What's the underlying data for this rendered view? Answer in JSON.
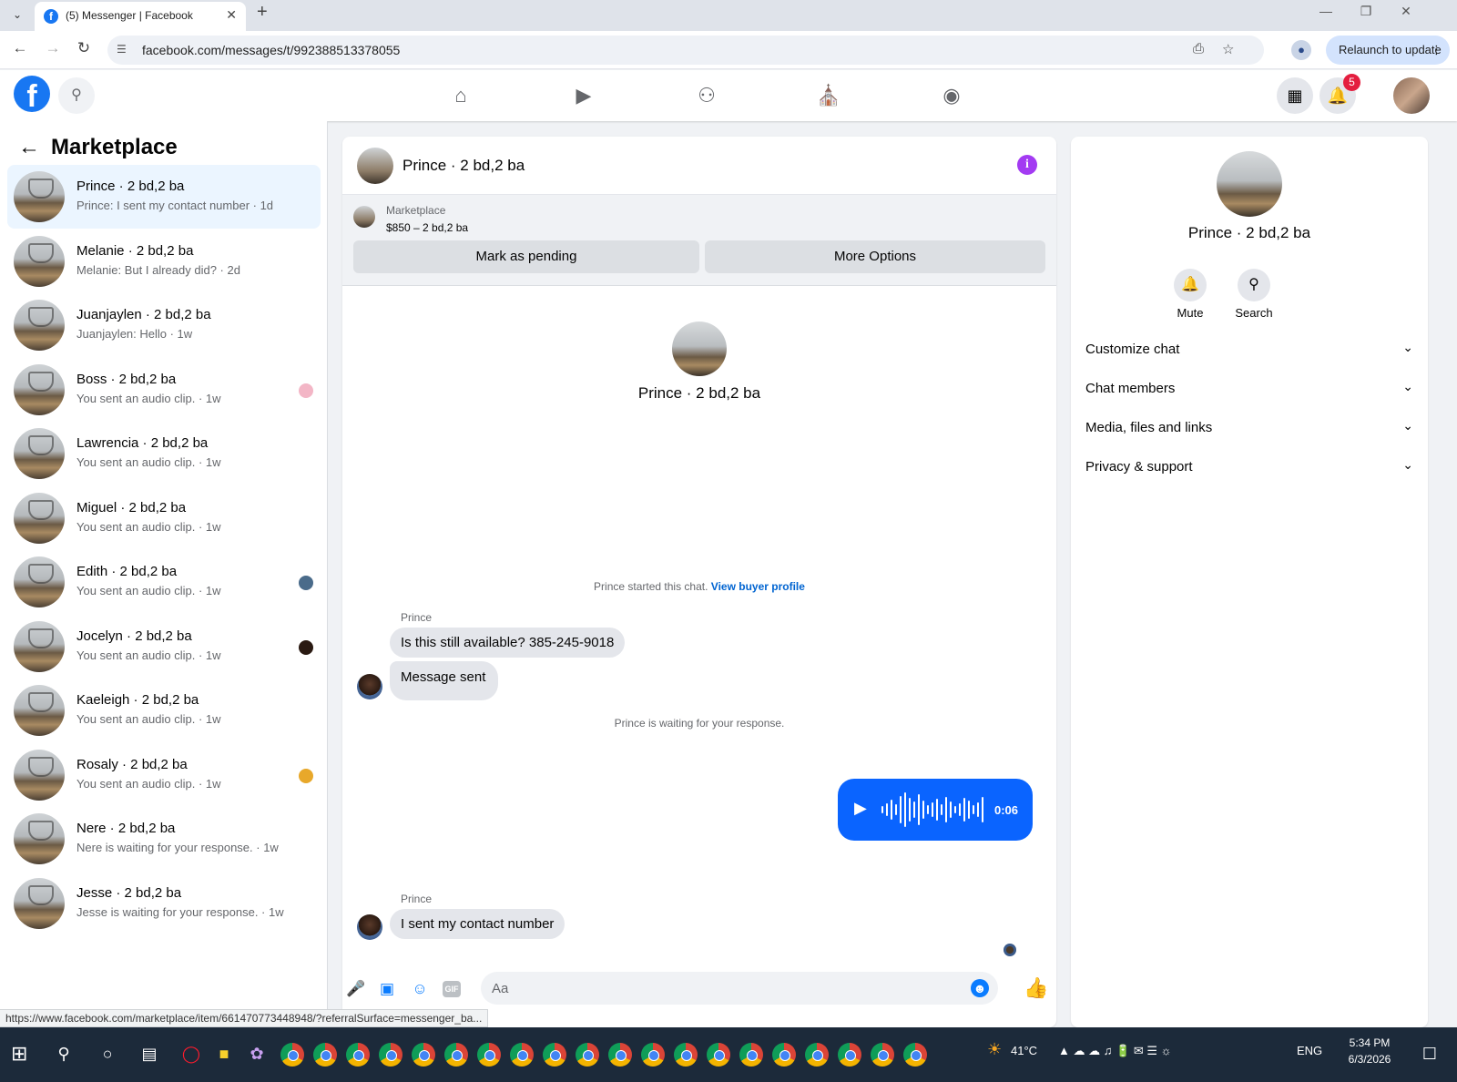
{
  "browser": {
    "tab_title": "(5) Messenger | Facebook",
    "url": "facebook.com/messages/t/992388513378055",
    "relaunch_label": "Relaunch to update",
    "status_url": "https://www.facebook.com/marketplace/item/661470773448948/?referralSurface=messenger_ba..."
  },
  "fb_header": {
    "notification_count": "5",
    "nav_icons": [
      "home-icon",
      "reels-icon",
      "friends-icon",
      "marketplace-icon",
      "groups-icon"
    ]
  },
  "sidebar": {
    "title": "Marketplace",
    "conversations": [
      {
        "name": "Prince · 2 bd,2 ba",
        "preview": "Prince: I sent my contact number · 1d",
        "active": true
      },
      {
        "name": "Melanie · 2 bd,2 ba",
        "preview": "Melanie: But I already did? · 2d"
      },
      {
        "name": "Juanjaylen · 2 bd,2 ba",
        "preview": "Juanjaylen: Hello · 1w"
      },
      {
        "name": "Boss · 2 bd,2 ba",
        "preview": "You sent an audio clip. · 1w",
        "seen_color": "#f3b6c6"
      },
      {
        "name": "Lawrencia · 2 bd,2 ba",
        "preview": "You sent an audio clip. · 1w"
      },
      {
        "name": "Miguel · 2 bd,2 ba",
        "preview": "You sent an audio clip. · 1w"
      },
      {
        "name": "Edith · 2 bd,2 ba",
        "preview": "You sent an audio clip. · 1w",
        "seen_color": "#4a6b8a"
      },
      {
        "name": "Jocelyn · 2 bd,2 ba",
        "preview": "You sent an audio clip. · 1w",
        "seen_color": "#2a1a12"
      },
      {
        "name": "Kaeleigh · 2 bd,2 ba",
        "preview": "You sent an audio clip. · 1w"
      },
      {
        "name": "Rosaly · 2 bd,2 ba",
        "preview": "You sent an audio clip. · 1w",
        "seen_color": "#e8a82a"
      },
      {
        "name": "Nere · 2 bd,2 ba",
        "preview": "Nere is waiting for your response. · 1w"
      },
      {
        "name": "Jesse · 2 bd,2 ba",
        "preview": "Jesse is waiting for your response. · 1w"
      }
    ]
  },
  "chat": {
    "header_name": "Prince · 2 bd,2 ba",
    "marketplace_label": "Marketplace",
    "listing": "$850 – 2 bd,2 ba",
    "mark_pending_label": "Mark as pending",
    "more_options_label": "More Options",
    "intro_name": "Prince · 2 bd,2 ba",
    "started_text": "Prince started this chat.",
    "view_profile_label": "View buyer profile",
    "messages": [
      {
        "sender": "Prince",
        "text": "Is this still available? 385-245-9018"
      },
      {
        "text": "Message sent"
      },
      {
        "sender": "Prince",
        "text": "I sent my contact number"
      }
    ],
    "waiting_text": "Prince is waiting for your response.",
    "audio_duration": "0:06",
    "composer_placeholder": "Aa",
    "gif_label": "GIF"
  },
  "info_panel": {
    "name": "Prince · 2 bd,2 ba",
    "mute_label": "Mute",
    "search_label": "Search",
    "sections": [
      "Customize chat",
      "Chat members",
      "Media, files and links",
      "Privacy & support"
    ]
  },
  "taskbar": {
    "temperature": "41°C",
    "language": "ENG",
    "time": "5:34 PM",
    "date": "6/3/2026"
  },
  "colors": {
    "fb_blue": "#1877f2",
    "messenger_blue": "#0a64ff",
    "active_row": "#ebf5ff",
    "info_purple": "#a33bf2",
    "badge_red": "#e41e3f"
  }
}
